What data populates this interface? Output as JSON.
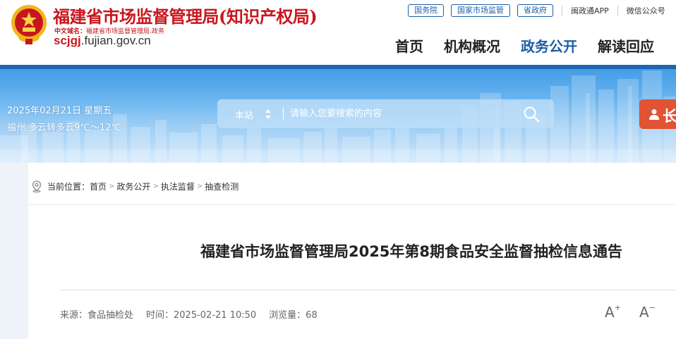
{
  "header": {
    "site_title": "福建省市场监督管理局(知识产权局)",
    "domain_label": "中文域名：",
    "domain_value": "福建省市场监督管理局.政务",
    "url_bold": "scjgj",
    "url_rest": ".fujian.gov.cn",
    "top_links": [
      "国务院",
      "国家市场监管",
      "省政府"
    ],
    "app_link": "闽政通APP",
    "wechat_link": "微信公众号",
    "nav": [
      {
        "label": "首页",
        "active": false
      },
      {
        "label": "机构概况",
        "active": false
      },
      {
        "label": "政务公开",
        "active": true
      },
      {
        "label": "解读回应",
        "active": false
      }
    ]
  },
  "banner": {
    "date": "2025年02月21日 星期五",
    "weather": "福州 多云转多云9℃～12℃",
    "search": {
      "scope": "本站",
      "placeholder": "请输入您要搜索的内容"
    },
    "service_label": "长"
  },
  "breadcrumb": {
    "prefix": "当前位置：",
    "items": [
      "首页",
      "政务公开",
      "执法监督",
      "抽查检测"
    ]
  },
  "article": {
    "title": "福建省市场监督管理局2025年第8期食品安全监督抽检信息通告",
    "source": "来源：食品抽检处",
    "time": "时间：2025-02-21 10:50",
    "views": "浏览量：68",
    "font_increase": "A",
    "font_decrease": "A"
  },
  "colors": {
    "brand_red": "#c8161d",
    "brand_blue": "#1d5ea8",
    "service_orange": "#e05333"
  }
}
